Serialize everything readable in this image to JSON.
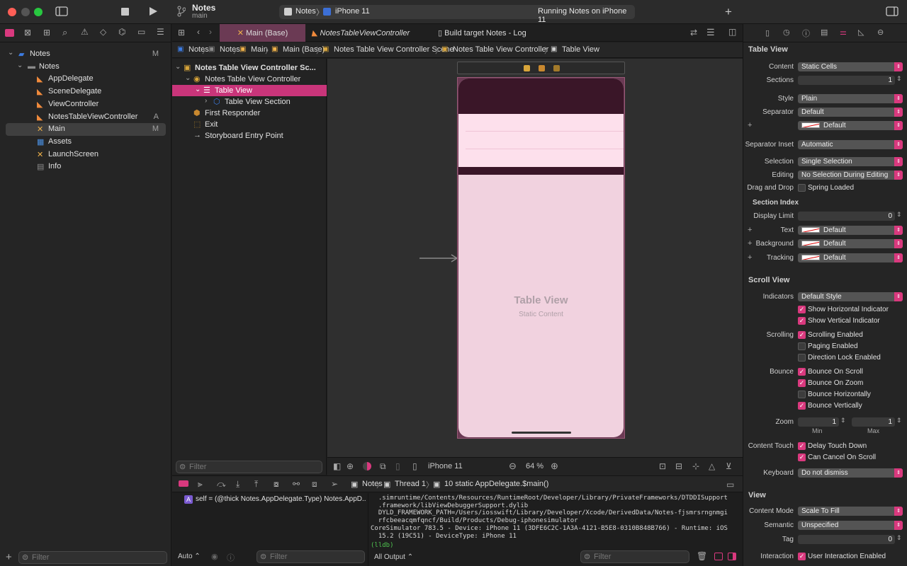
{
  "toolbar": {
    "project_name": "Notes",
    "branch": "main",
    "scheme": "Notes",
    "device": "iPhone 11",
    "status": "Running Notes on iPhone 11",
    "accent": "#d9397e"
  },
  "navigator": {
    "items": [
      {
        "label": "Notes",
        "icon": "project-icon",
        "badge": "M",
        "indent": 0
      },
      {
        "label": "Notes",
        "icon": "folder-icon",
        "badge": "",
        "indent": 1
      },
      {
        "label": "AppDelegate",
        "icon": "swift-file-icon",
        "badge": "",
        "indent": 2
      },
      {
        "label": "SceneDelegate",
        "icon": "swift-file-icon",
        "badge": "",
        "indent": 2
      },
      {
        "label": "ViewController",
        "icon": "swift-file-icon",
        "badge": "",
        "indent": 2
      },
      {
        "label": "NotesTableViewController",
        "icon": "swift-file-icon",
        "badge": "A",
        "indent": 2
      },
      {
        "label": "Main",
        "icon": "storyboard-icon",
        "badge": "M",
        "indent": 2
      },
      {
        "label": "Assets",
        "icon": "asset-catalog-icon",
        "badge": "",
        "indent": 2
      },
      {
        "label": "LaunchScreen",
        "icon": "storyboard-icon",
        "badge": "",
        "indent": 2
      },
      {
        "label": "Info",
        "icon": "plist-icon",
        "badge": "",
        "indent": 2
      }
    ],
    "filter_placeholder": "Filter"
  },
  "tabs": [
    {
      "label": "Main (Base)"
    },
    {
      "label": "NotesTableViewController"
    },
    {
      "label": "Build target Notes - Log"
    }
  ],
  "breadcrumbs": [
    "Notes",
    "Notes",
    "Main",
    "Main (Base)",
    "Notes Table View Controller Scene",
    "Notes Table View Controller",
    "Table View"
  ],
  "outline": {
    "items": [
      {
        "label": "Notes Table View Controller Sc...",
        "indent": 0
      },
      {
        "label": "Notes Table View Controller",
        "indent": 1
      },
      {
        "label": "Table View",
        "indent": 2
      },
      {
        "label": "Table View Section",
        "indent": 3
      },
      {
        "label": "First Responder",
        "indent": 1
      },
      {
        "label": "Exit",
        "indent": 1
      },
      {
        "label": "Storyboard Entry Point",
        "indent": 1
      }
    ],
    "filter_placeholder": "Filter"
  },
  "canvas": {
    "title": "Table View",
    "subtitle": "Static Content",
    "device": "iPhone 11",
    "zoom": "64 %"
  },
  "debug": {
    "crumbs": [
      "Notes",
      "Thread 1",
      "10 static AppDelegate.$main()"
    ],
    "var_line": "self = (@thick Notes.AppDelegate.Type) Notes.AppD...",
    "console_lines": [
      "  .simruntime/Contents/Resources/RuntimeRoot/Developer/Library/PrivateFrameworks/DTDDISupport",
      "  .framework/libViewDebuggerSupport.dylib",
      "  DYLD_FRAMEWORK_PATH=/Users/iosswift/Library/Developer/Xcode/DerivedData/Notes-fjsmrsrngnmgi",
      "  rfcbeeacqmfqncf/Build/Products/Debug-iphonesimulator",
      "CoreSimulator 783.5 - Device: iPhone 11 (3DFE6C2C-1A3A-4121-B5E8-0310B848B766) - Runtime: iOS",
      "  15.2 (19C51) - DeviceType: iPhone 11"
    ],
    "prompt": "(lldb)",
    "auto_label": "Auto",
    "output_label": "All Output",
    "filter_placeholder": "Filter"
  },
  "inspector": {
    "table_view_header": "Table View",
    "content_label": "Content",
    "content_value": "Static Cells",
    "sections_label": "Sections",
    "sections_value": "1",
    "style_label": "Style",
    "style_value": "Plain",
    "separator_label": "Separator",
    "separator_value": "Default",
    "separator_color": "Default",
    "separator_inset_label": "Separator Inset",
    "separator_inset_value": "Automatic",
    "selection_label": "Selection",
    "selection_value": "Single Selection",
    "editing_label": "Editing",
    "editing_value": "No Selection During Editing",
    "drag_drop_label": "Drag and Drop",
    "spring_loaded": "Spring Loaded",
    "section_index_header": "Section Index",
    "display_limit_label": "Display Limit",
    "display_limit_value": "0",
    "text_label": "Text",
    "text_value": "Default",
    "background_label": "Background",
    "background_value": "Default",
    "tracking_label": "Tracking",
    "tracking_value": "Default",
    "scroll_view_header": "Scroll View",
    "indicators_label": "Indicators",
    "indicators_value": "Default Style",
    "show_h": "Show Horizontal Indicator",
    "show_v": "Show Vertical Indicator",
    "scrolling_label": "Scrolling",
    "scrolling_enabled": "Scrolling Enabled",
    "paging_enabled": "Paging Enabled",
    "direction_lock": "Direction Lock Enabled",
    "bounce_label": "Bounce",
    "bounce_scroll": "Bounce On Scroll",
    "bounce_zoom": "Bounce On Zoom",
    "bounce_h": "Bounce Horizontally",
    "bounce_v": "Bounce Vertically",
    "zoom_label": "Zoom",
    "zoom_min": "1",
    "zoom_max": "1",
    "min_label": "Min",
    "max_label": "Max",
    "content_touch_label": "Content Touch",
    "delay_touch": "Delay Touch Down",
    "can_cancel": "Can Cancel On Scroll",
    "keyboard_label": "Keyboard",
    "keyboard_value": "Do not dismiss",
    "view_header": "View",
    "content_mode_label": "Content Mode",
    "content_mode_value": "Scale To Fill",
    "semantic_label": "Semantic",
    "semantic_value": "Unspecified",
    "tag_label": "Tag",
    "tag_value": "0",
    "interaction_label": "Interaction",
    "user_interaction": "User Interaction Enabled"
  }
}
